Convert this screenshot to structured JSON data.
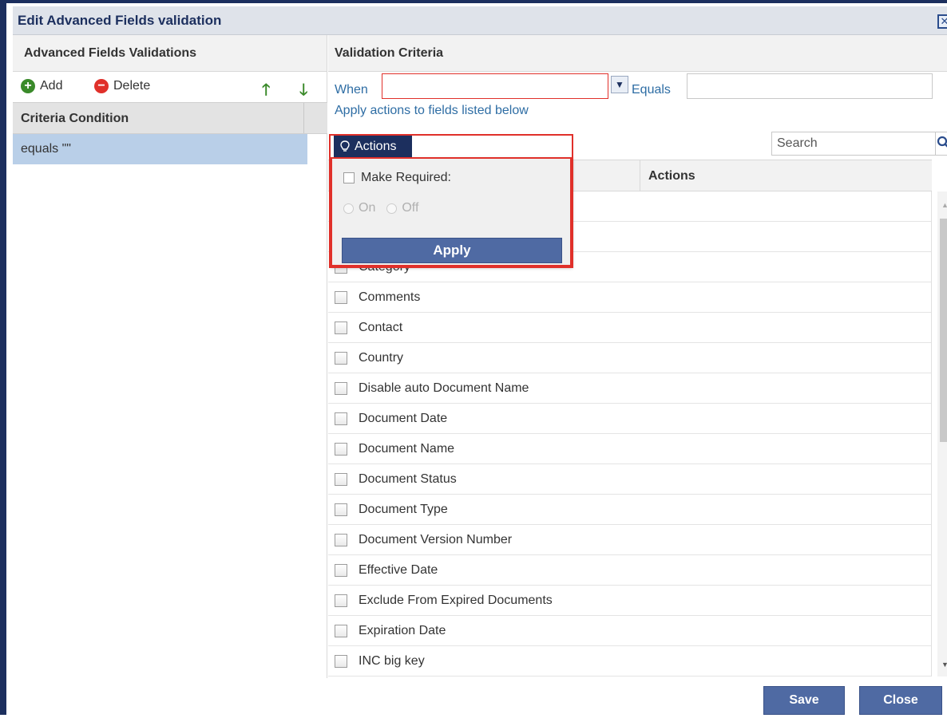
{
  "dialog": {
    "title": "Edit Advanced Fields validation",
    "close_glyph": "✕"
  },
  "left": {
    "header": "Advanced Fields Validations",
    "add_label": "Add",
    "delete_label": "Delete",
    "criteria_header": "Criteria Condition",
    "criteria_rows": [
      "equals \"\""
    ]
  },
  "right": {
    "header": "Validation Criteria",
    "when_label": "When",
    "when_value": "",
    "equals_label": "Equals",
    "equals_value": "",
    "apply_link": "Apply actions to fields listed below",
    "search_placeholder": "Search",
    "actions_column": "Actions",
    "fields": [
      "Category",
      "Comments",
      "Contact",
      "Country",
      "Disable auto Document Name",
      "Document Date",
      "Document Name",
      "Document Status",
      "Document Type",
      "Document Version Number",
      "Effective Date",
      "Exclude From Expired Documents",
      "Expiration Date",
      "INC big key"
    ]
  },
  "popup": {
    "tab_label": "Actions",
    "make_required_label": "Make Required:",
    "on_label": "On",
    "off_label": "Off",
    "apply_label": "Apply"
  },
  "footer": {
    "save_label": "Save",
    "close_label": "Close"
  },
  "colors": {
    "accent_dark": "#1c2f5e",
    "button_blue": "#4f6aa3",
    "selection_blue": "#b9cfe8",
    "highlight_red": "#e0302a",
    "link_blue": "#2e6da4",
    "add_green": "#3a8a2a",
    "delete_red": "#e0302a"
  }
}
